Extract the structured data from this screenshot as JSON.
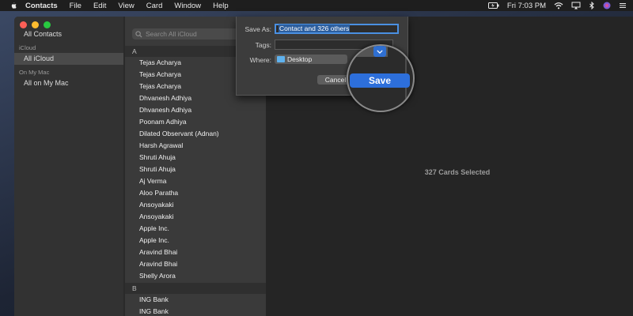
{
  "menubar": {
    "app_name": "Contacts",
    "items": [
      "File",
      "Edit",
      "View",
      "Card",
      "Window",
      "Help"
    ],
    "clock": "Fri 7:03 PM"
  },
  "sidebar": {
    "all_contacts": "All Contacts",
    "icloud_section": "iCloud",
    "all_icloud": "All iCloud",
    "on_my_mac_section": "On My Mac",
    "all_on_my_mac": "All on My Mac"
  },
  "search": {
    "placeholder": "Search All iCloud"
  },
  "groups": {
    "a": "A",
    "b": "B"
  },
  "contacts_a": [
    "Tejas Acharya",
    "Tejas Acharya",
    "Tejas Acharya",
    "Dhvanesh Adhiya",
    "Dhvanesh Adhiya",
    "Poonam Adhiya",
    "Dilated Observant (Adnan)",
    "Harsh Agrawal",
    "Shruti Ahuja",
    "Shruti Ahuja",
    "Aj Verma",
    "Aloo Paratha",
    "Ansoyakaki",
    "Ansoyakaki",
    "Apple Inc.",
    "Apple Inc.",
    "Aravind Bhai",
    "Aravind Bhai",
    "Shelly Arora"
  ],
  "contacts_b": [
    "ING Bank",
    "ING Bank"
  ],
  "detail": {
    "cards_selected": "327 Cards Selected"
  },
  "save_sheet": {
    "save_as_label": "Save As:",
    "save_as_value": "Contact and 326 others",
    "tags_label": "Tags:",
    "where_label": "Where:",
    "where_value": "Desktop",
    "cancel_label": "Cancel",
    "save_label": "Save"
  },
  "colors": {
    "accent": "#2d6fdb",
    "close": "#fc5f57",
    "minimize": "#fdbb2f",
    "zoom": "#28c840"
  },
  "icons": [
    "apple-icon",
    "battery-icon",
    "wifi-icon",
    "bluetooth-icon",
    "siri-icon",
    "spotlight-icon",
    "search-icon",
    "folder-icon",
    "chevron-down-icon"
  ]
}
